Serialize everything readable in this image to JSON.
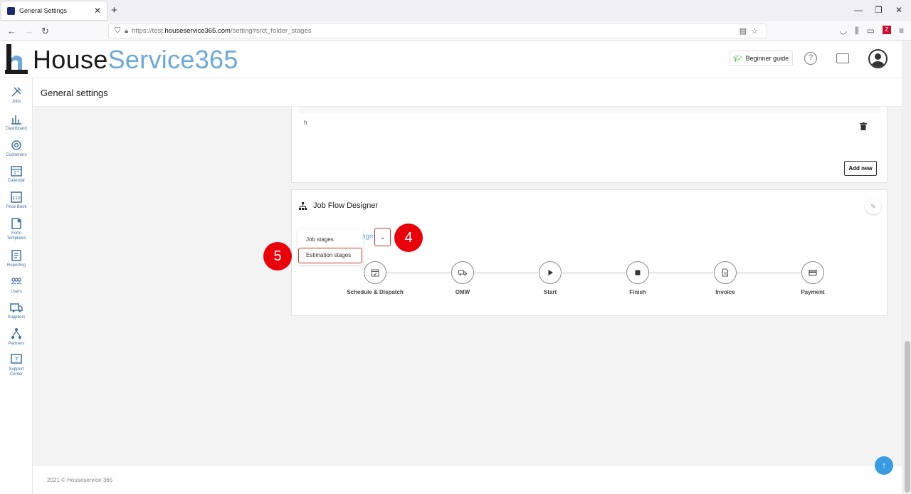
{
  "browser": {
    "tab_title": "General Settings",
    "tab_close": "✕",
    "new_tab": "+",
    "url_prefix": "https://test.",
    "url_domain": "houseservice365.com",
    "url_path": "/setting#srct_folder_stages",
    "win_min": "—",
    "win_restore": "❐",
    "win_close": "✕"
  },
  "header": {
    "logo_part1": "House",
    "logo_part2": "Service365",
    "beginner_guide": "Beginner guide",
    "help_glyph": "?"
  },
  "sidebar": {
    "items": [
      {
        "label": "Jobs",
        "icon": "tools-icon"
      },
      {
        "label": "Dashboard",
        "icon": "bar-chart-icon"
      },
      {
        "label": "Customers",
        "icon": "target-icon"
      },
      {
        "label": "Calendar",
        "icon": "calendar-icon"
      },
      {
        "label": "Price Book",
        "icon": "price-tag-icon"
      },
      {
        "label": "Form",
        "label2": "Templates",
        "icon": "form-icon"
      },
      {
        "label": "Reporting",
        "icon": "report-icon"
      },
      {
        "label": "Users",
        "icon": "users-icon"
      },
      {
        "label": "Suppliers",
        "icon": "truck-icon"
      },
      {
        "label": "Partners",
        "icon": "network-icon"
      },
      {
        "label": "Support",
        "label2": "Center",
        "icon": "question-icon"
      }
    ]
  },
  "page": {
    "title": "General settings"
  },
  "card_top": {
    "row_text": "h",
    "add_new": "Add new"
  },
  "job_flow": {
    "title": "Job Flow Designer",
    "selected_partial": "ages",
    "menu": {
      "job_stages": "Job stages",
      "estimation_stages": "Estimation stages"
    },
    "stages": [
      {
        "label": "Schedule & Dispatch",
        "icon": "calendar-check-icon"
      },
      {
        "label": "OMW",
        "icon": "truck-icon"
      },
      {
        "label": "Start",
        "icon": "play-icon"
      },
      {
        "label": "Finish",
        "icon": "stop-icon"
      },
      {
        "label": "Invoice",
        "icon": "document-icon"
      },
      {
        "label": "Payment",
        "icon": "credit-card-icon"
      }
    ]
  },
  "annotations": {
    "step4": "4",
    "step5": "5"
  },
  "footer": {
    "copyright": "2021 © Houseservice 365"
  },
  "colors": {
    "brand_blue": "#6ea8d8",
    "annotation_red": "#e8000b",
    "sidebar_text": "#3d6f9e",
    "scroll_top": "#3a9ce0"
  }
}
